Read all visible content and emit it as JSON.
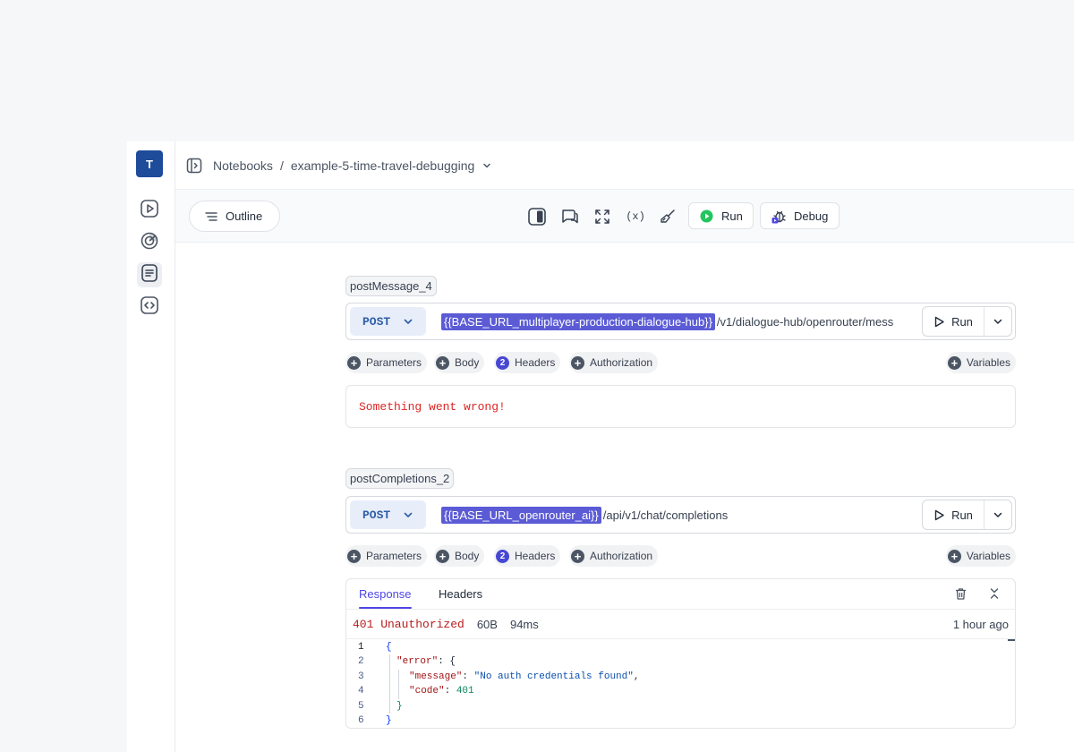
{
  "user": {
    "avatar_initial": "T"
  },
  "breadcrumb": {
    "root": "Notebooks",
    "separator": "/",
    "current": "example-5-time-travel-debugging"
  },
  "toolbar": {
    "outline_label": "Outline",
    "variables_glyph": "(x)",
    "run_label": "Run",
    "debug_label": "Debug"
  },
  "requests": [
    {
      "name": "postMessage_4",
      "method": "POST",
      "base_var": "{{BASE_URL_multiplayer-production-dialogue-hub}}",
      "path": "/v1/dialogue-hub/openrouter/mess",
      "run_label": "Run",
      "chips": {
        "parameters": "Parameters",
        "body": "Body",
        "headers_count": "2",
        "headers": "Headers",
        "authorization": "Authorization",
        "variables": "Variables"
      },
      "error_text": "Something went wrong!"
    },
    {
      "name": "postCompletions_2",
      "method": "POST",
      "base_var": "{{BASE_URL_openrouter_ai}}",
      "path": "/api/v1/chat/completions",
      "run_label": "Run",
      "chips": {
        "parameters": "Parameters",
        "body": "Body",
        "headers_count": "2",
        "headers": "Headers",
        "authorization": "Authorization",
        "variables": "Variables"
      },
      "response": {
        "tabs": [
          "Response",
          "Headers"
        ],
        "status": "401 Unauthorized",
        "size": "60B",
        "time": "94ms",
        "when": "1 hour ago",
        "line_numbers": [
          "1",
          "2",
          "3",
          "4",
          "5",
          "6"
        ],
        "body": {
          "l1": "{",
          "l2_key": "\"error\"",
          "l2_rest": ": {",
          "l3_key": "\"message\"",
          "l3_colon": ": ",
          "l3_val": "\"No auth credentials found\"",
          "l3_comma": ",",
          "l4_key": "\"code\"",
          "l4_colon": ": ",
          "l4_val": "401",
          "l5": "}",
          "l6": "}"
        }
      }
    }
  ],
  "colors": {
    "accent": "#4f46e5",
    "variable_chip": "#5b5bd6",
    "error": "#dc2626",
    "status_error": "#b91c1c",
    "run_green": "#22c55e"
  }
}
